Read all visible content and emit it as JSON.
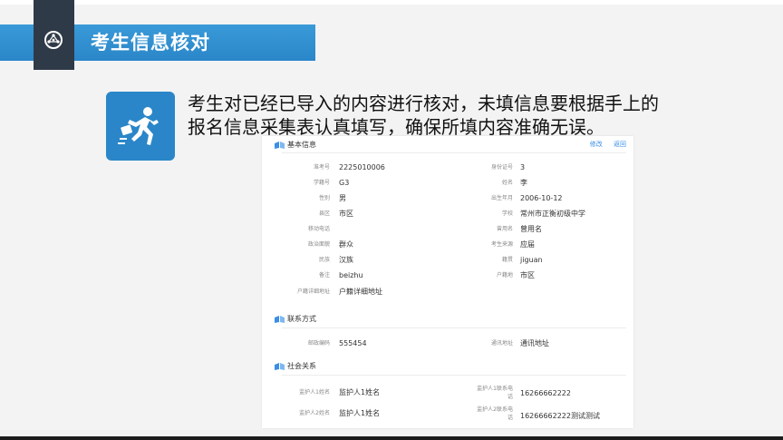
{
  "header": {
    "title": "考生信息核对"
  },
  "instruction": {
    "line1": "考生对已经已导入的内容进行核对，未填信息要根据手上的",
    "line2": "报名信息采集表认真填写，确保所填内容准确无误。"
  },
  "form": {
    "basic": {
      "title": "基本信息",
      "edit_link": "修改",
      "back_link": "返回",
      "rows": [
        {
          "left_label": "准考号",
          "left_value": "2225010006",
          "right_label": "身份证号",
          "right_value": "3"
        },
        {
          "left_label": "学籍号",
          "left_value": "G3",
          "right_label": "姓名",
          "right_value": "李"
        },
        {
          "left_label": "性别",
          "left_value": "男",
          "right_label": "出生年月",
          "right_value": "2006-10-12"
        },
        {
          "left_label": "县区",
          "left_value": "市区",
          "right_label": "学校",
          "right_value": "常州市正衡初级中学"
        },
        {
          "left_label": "移动电话",
          "left_value": "",
          "right_label": "曾用名",
          "right_value": "曾用名"
        },
        {
          "left_label": "政治面貌",
          "left_value": "群众",
          "right_label": "考生来源",
          "right_value": "应届"
        },
        {
          "left_label": "民族",
          "left_value": "汉族",
          "right_label": "籍贯",
          "right_value": "jiguan"
        },
        {
          "left_label": "备注",
          "left_value": "beizhu",
          "right_label": "户籍地",
          "right_value": "市区"
        },
        {
          "left_label": "户籍详细地址",
          "left_value": "户籍详细地址",
          "right_label": "",
          "right_value": ""
        }
      ]
    },
    "contact": {
      "title": "联系方式",
      "rows": [
        {
          "left_label": "邮政编码",
          "left_value": "555454",
          "right_label": "通讯地址",
          "right_value": "通讯地址"
        }
      ]
    },
    "social": {
      "title": "社会关系",
      "rows": [
        {
          "left_label": "监护人1姓名",
          "left_value": "监护人1姓名",
          "right_label_a": "监护人1联系电",
          "right_label_b": "话",
          "right_value": "16266662222"
        },
        {
          "left_label": "监护人2姓名",
          "left_value": "监护人1姓名",
          "right_label_a": "监护人2联系电",
          "right_label_b": "话",
          "right_value": "16266662222测试测试"
        }
      ]
    }
  },
  "colors": {
    "accent": "#2a86c8",
    "dark_tab": "#2f3a48",
    "background": "#f3f3f4",
    "link": "#3a8ee6"
  },
  "icons": {
    "tab_icon": "network-globe-icon",
    "tile_icon": "running-person-icon",
    "section_icon": "book-icon"
  }
}
